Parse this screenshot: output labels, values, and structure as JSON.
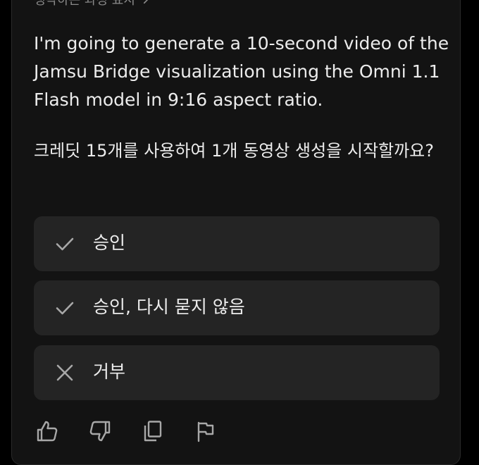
{
  "thinking_toggle": {
    "label": "생각하는 과정 표시",
    "icon": "chevron-right-icon"
  },
  "message": {
    "paragraph": "I'm going to generate a 10-second video of the Jamsu Bridge visualization using the Omni 1.1 Flash model in 9:16 aspect ratio."
  },
  "question": {
    "text": "크레딧 15개를 사용하여 1개 동영상 생성을 시작할까요?"
  },
  "options": [
    {
      "label": "승인",
      "icon": "check-icon"
    },
    {
      "label": "승인, 다시 묻지 않음",
      "icon": "check-icon"
    },
    {
      "label": "거부",
      "icon": "close-icon"
    }
  ],
  "actions": [
    {
      "name": "thumbs-up",
      "icon": "thumbs-up-icon"
    },
    {
      "name": "thumbs-down",
      "icon": "thumbs-down-icon"
    },
    {
      "name": "copy",
      "icon": "copy-icon"
    },
    {
      "name": "flag",
      "icon": "flag-icon"
    }
  ],
  "colors": {
    "background": "#000000",
    "panel": "#131313",
    "option_background": "#242424",
    "text": "#ececec",
    "muted": "#8a8a8a",
    "icon": "#a8a8a8"
  }
}
